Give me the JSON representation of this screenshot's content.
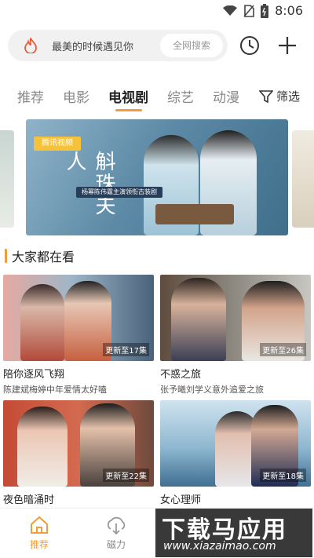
{
  "status": {
    "time": "8:06"
  },
  "search": {
    "hint": "最美的时候遇见你",
    "button": "全网搜索"
  },
  "tabs": [
    {
      "label": "推荐"
    },
    {
      "label": "电影"
    },
    {
      "label": "电视剧"
    },
    {
      "label": "综艺"
    },
    {
      "label": "动漫"
    }
  ],
  "filter": {
    "label": "筛选"
  },
  "banner": {
    "badge": "腾讯视频",
    "title": "斛珠夫人",
    "subtitle": "杨幂陈伟霆主演领衔古装剧"
  },
  "section": {
    "title": "大家都在看"
  },
  "cards": [
    {
      "name": "陪你逐风飞翔",
      "desc": "陈建斌梅婷中年爱情太好嗑",
      "episode": "更新至17集"
    },
    {
      "name": "不惑之旅",
      "desc": "张予曦刘学义意外追爱之旅",
      "episode": "更新至26集"
    },
    {
      "name": "夜色暗涌时",
      "desc": "",
      "episode": "更新至22集"
    },
    {
      "name": "女心理师",
      "desc": "",
      "episode": "更新至18集"
    }
  ],
  "nav": [
    {
      "label": "推荐"
    },
    {
      "label": "磁力"
    }
  ],
  "watermark": {
    "line1": "下载马应用",
    "line2": "www.xiazaimao.com"
  },
  "colors": {
    "accent": "#f39c3a"
  }
}
